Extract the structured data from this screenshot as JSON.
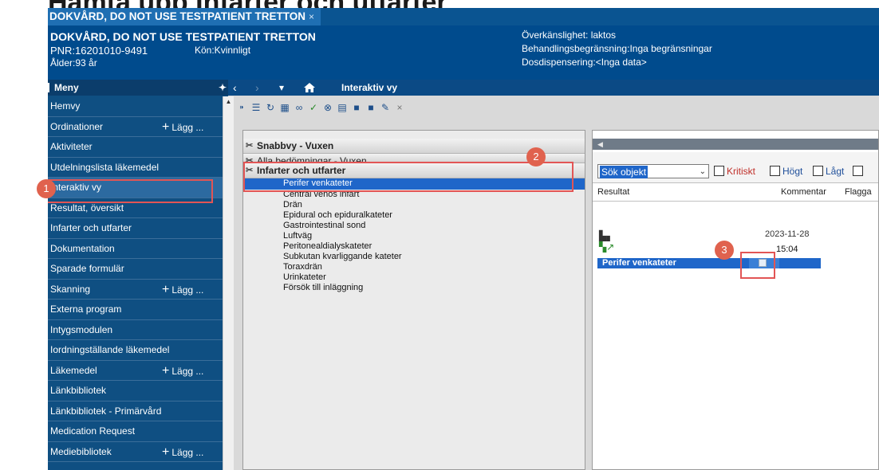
{
  "heading": "Hämta upp Infarter och utfarter",
  "window": {
    "tab_label": "DOKVÅRD, DO NOT USE TESTPATIENT TRETTON",
    "tab_close": "×"
  },
  "patient": {
    "name": "DOKVÅRD, DO NOT USE TESTPATIENT TRETTON",
    "pnr": "PNR:16201010-9491",
    "sex": "Kön:Kvinnligt",
    "age": "Ålder:93 år",
    "allergy": "Överkänslighet: laktos",
    "restriction": "Behandlingsbegränsning:Inga begränsningar",
    "dispensing": "Dosdispensering:<Inga data>"
  },
  "sidebar": {
    "header": "Meny",
    "pin_icon": "pin-icon",
    "items": [
      {
        "label": "Hemvy"
      },
      {
        "label": "Ordinationer",
        "add": "Lägg ..."
      },
      {
        "label": "Aktiviteter"
      },
      {
        "label": "Utdelningslista läkemedel"
      },
      {
        "label": "Interaktiv vy",
        "active": true
      },
      {
        "label": "Resultat, översikt"
      },
      {
        "label": "Infarter och utfarter"
      },
      {
        "label": "Dokumentation"
      },
      {
        "label": "Sparade formulär"
      },
      {
        "label": "Skanning",
        "add": "Lägg ..."
      },
      {
        "label": "Externa program"
      },
      {
        "label": "Intygsmodulen"
      },
      {
        "label": "Iordningställande läkemedel"
      },
      {
        "label": "Läkemedel",
        "add": "Lägg ..."
      },
      {
        "label": "Länkbibliotek"
      },
      {
        "label": "Länkbibliotek - Primärvård"
      },
      {
        "label": "Medication Request"
      },
      {
        "label": "Mediebibliotek",
        "add": "Lägg ..."
      }
    ]
  },
  "navbar": {
    "back": "‹",
    "forward": "›",
    "dropdown": "▾",
    "home_icon": "home-icon",
    "title": "Interaktiv vy"
  },
  "tree": {
    "headers": [
      "Snabbvy - Vuxen",
      "Alla bedömningar - Vuxen",
      "Infarter och utfarter"
    ],
    "items": [
      "Perifer venkateter",
      "Central venös infart",
      "Drän",
      "Epidural och epiduralkateter",
      "Gastrointestinal sond",
      "Luftväg",
      "Peritonealdialyskateter",
      "Subkutan kvarliggande kateter",
      "Toraxdrän",
      "Urinkateter",
      "Försök till inläggning"
    ],
    "selected": "Perifer venkateter"
  },
  "right": {
    "search_value": "Sök objekt",
    "checkboxes": [
      "Kritiskt",
      "Högt",
      "Lågt"
    ],
    "columns": [
      "Resultat",
      "Kommentar",
      "Flagga"
    ],
    "date": "2023-11-28",
    "time": "15:04",
    "row_label": "Perifer venkateter"
  },
  "annotations": [
    "1",
    "2",
    "3"
  ],
  "colors": {
    "accent": "#004b8d",
    "sidebar": "#0f4f82",
    "highlight": "#e25555",
    "selection": "#1f66c9"
  }
}
